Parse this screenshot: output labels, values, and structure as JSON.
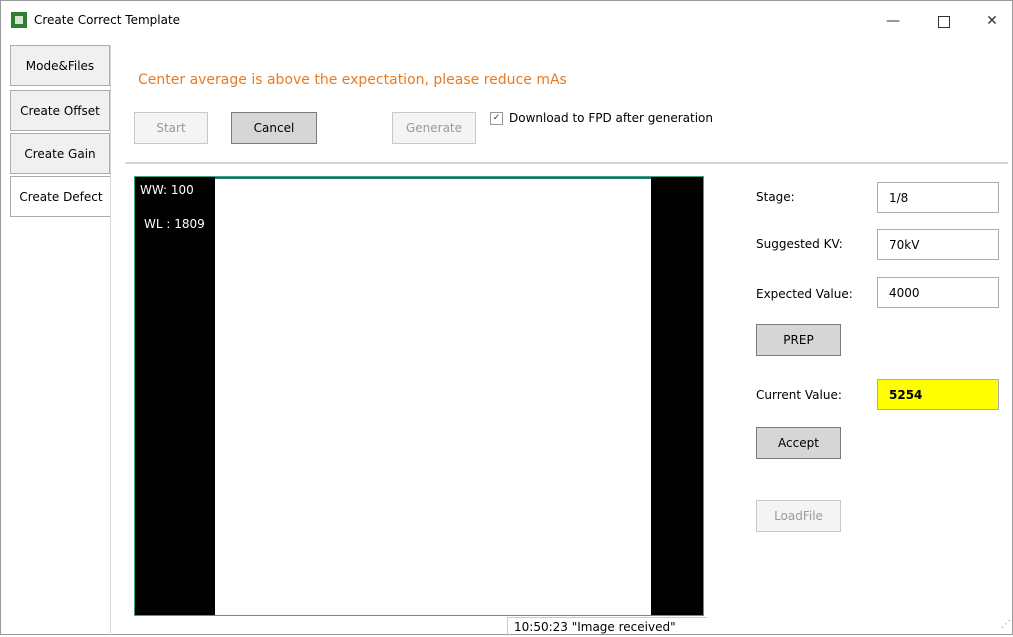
{
  "window": {
    "title": "Create Correct Template",
    "minimize_glyph": "—",
    "close_glyph": "✕"
  },
  "tabs": [
    {
      "label": "Mode&Files"
    },
    {
      "label": "Create Offset"
    },
    {
      "label": "Create Gain"
    },
    {
      "label": "Create Defect"
    }
  ],
  "message": "Center average is above the expectation, please reduce mAs",
  "toolbar": {
    "start_label": "Start",
    "cancel_label": "Cancel",
    "generate_label": "Generate",
    "download_label": "Download to FPD after generation",
    "download_checked": true
  },
  "viewer": {
    "ww_text": "WW:  100",
    "wl_text": "WL :  1809"
  },
  "panel": {
    "stage_label": "Stage:",
    "stage_value": "1/8",
    "kv_label": "Suggested KV:",
    "kv_value": "70kV",
    "expected_label": "Expected Value:",
    "expected_value": "4000",
    "prep_label": "PREP",
    "current_label": "Current Value:",
    "current_value": "5254",
    "accept_label": "Accept",
    "loadfile_label": "LoadFile"
  },
  "status": {
    "text": "10:50:23 \"Image received\""
  },
  "colors": {
    "warning": "#e87b22",
    "current_highlight": "#ffff00",
    "viewer_border": "#3aa58a"
  }
}
